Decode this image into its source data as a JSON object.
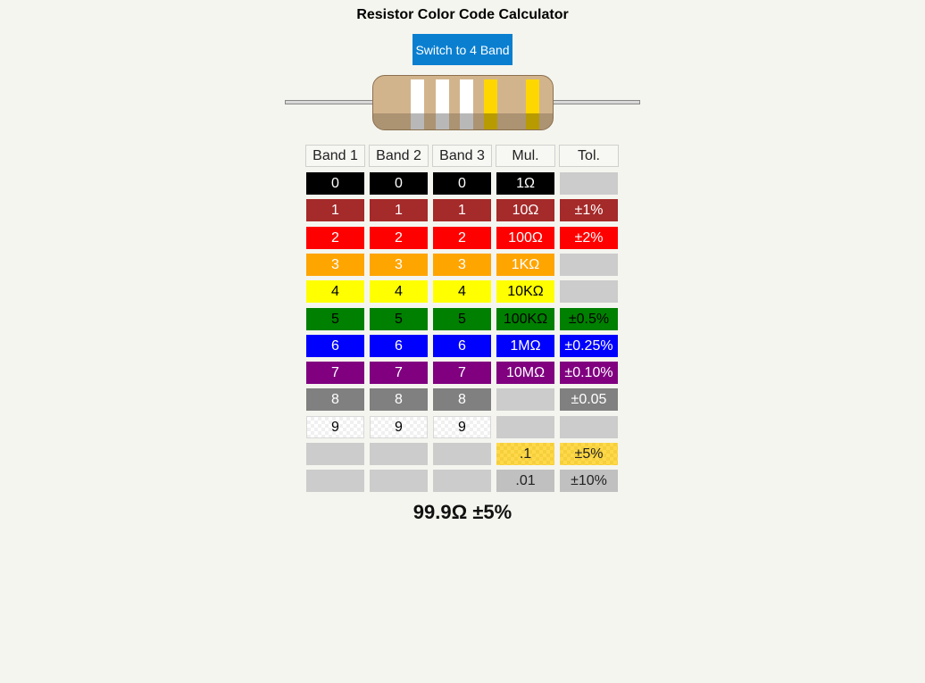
{
  "app": {
    "title": "Resistor Color Code Calculator",
    "switch_button_label": "Switch to 4 Band"
  },
  "resistor": {
    "body_color": "#d2b48c",
    "bands": [
      {
        "name": "band-1",
        "color": "#ffffff"
      },
      {
        "name": "band-2",
        "color": "#ffffff"
      },
      {
        "name": "band-3",
        "color": "#ffffff"
      },
      {
        "name": "multiplier-band",
        "color": "#ffd700"
      },
      {
        "name": "tolerance-band",
        "color": "#ffd700"
      }
    ]
  },
  "table": {
    "headers": [
      "Band 1",
      "Band 2",
      "Band 3",
      "Mul.",
      "Tol."
    ],
    "rows": [
      {
        "color": "black",
        "cells": [
          "0",
          "0",
          "0",
          "1Ω",
          ""
        ]
      },
      {
        "color": "brown",
        "cells": [
          "1",
          "1",
          "1",
          "10Ω",
          "±1%"
        ]
      },
      {
        "color": "red",
        "cells": [
          "2",
          "2",
          "2",
          "100Ω",
          "±2%"
        ]
      },
      {
        "color": "orange",
        "cells": [
          "3",
          "3",
          "3",
          "1KΩ",
          ""
        ]
      },
      {
        "color": "yellow",
        "cells": [
          "4",
          "4",
          "4",
          "10KΩ",
          ""
        ]
      },
      {
        "color": "green",
        "cells": [
          "5",
          "5",
          "5",
          "100KΩ",
          "±0.5%"
        ]
      },
      {
        "color": "blue",
        "cells": [
          "6",
          "6",
          "6",
          "1MΩ",
          "±0.25%"
        ]
      },
      {
        "color": "violet",
        "cells": [
          "7",
          "7",
          "7",
          "10MΩ",
          "±0.10%"
        ]
      },
      {
        "color": "grey",
        "cells": [
          "8",
          "8",
          "8",
          "",
          "±0.05"
        ]
      },
      {
        "color": "white",
        "cells": [
          "9",
          "9",
          "9",
          "",
          ""
        ]
      },
      {
        "color": "gold",
        "cells": [
          "",
          "",
          "",
          ".1",
          "±5%"
        ]
      },
      {
        "color": "silver",
        "cells": [
          "",
          "",
          "",
          ".01",
          "±10%"
        ]
      }
    ]
  },
  "result": {
    "value": "99.9Ω ±5%"
  }
}
